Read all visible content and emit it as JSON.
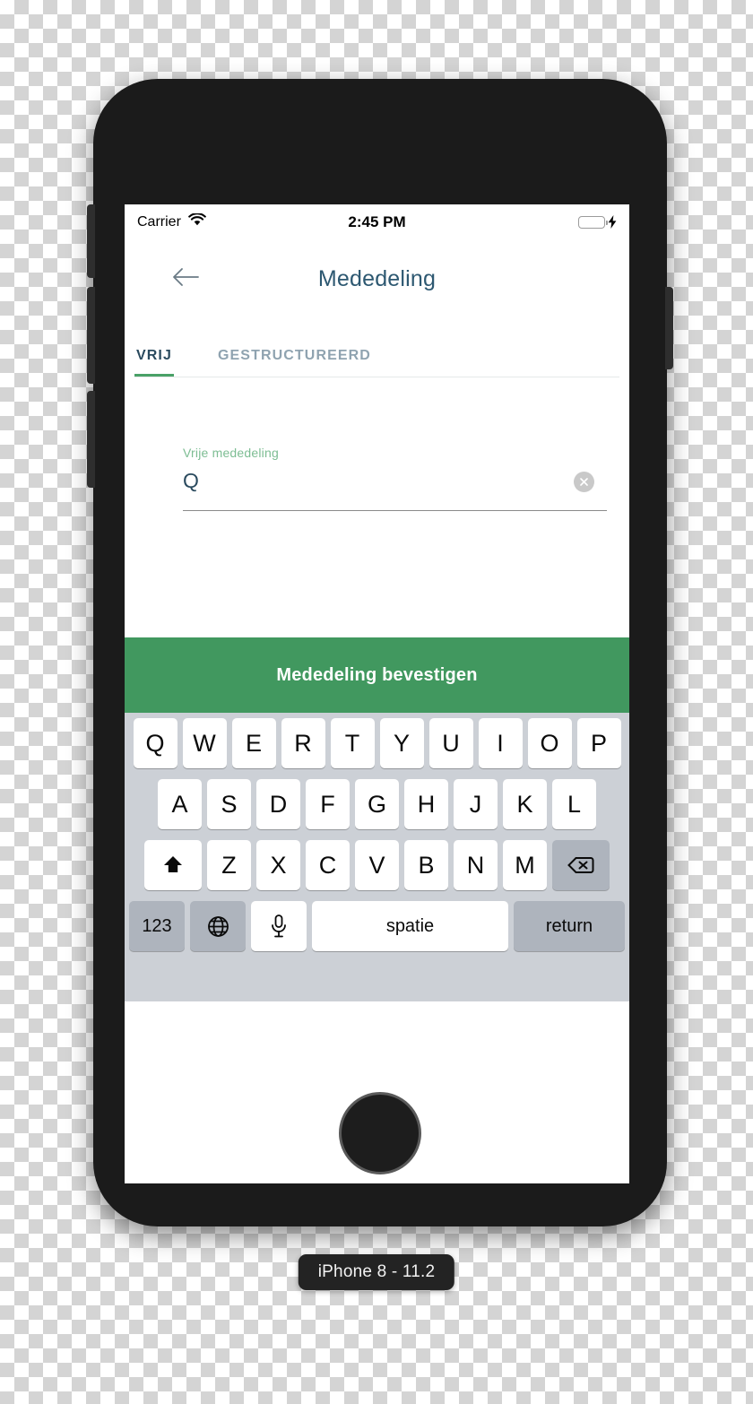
{
  "status_bar": {
    "carrier": "Carrier",
    "wifi_icon": "wifi-icon",
    "time": "2:45 PM",
    "battery_icon": "battery-icon",
    "charging_icon": "⚡",
    "battery_color": "#6fcf74"
  },
  "nav": {
    "back_icon": "arrow-left-icon",
    "title": "Mededeling"
  },
  "tabs": [
    {
      "label": "VRIJ",
      "active": true
    },
    {
      "label": "GESTRUCTUREERD",
      "active": false
    }
  ],
  "form": {
    "field_label": "Vrije mededeling",
    "field_value": "Q",
    "field_placeholder": "Vrije mededeling",
    "clear_icon": "clear-circle-icon"
  },
  "confirm": {
    "label": "Mededeling bevestigen",
    "color": "#41985f"
  },
  "keyboard": {
    "row1": [
      "Q",
      "W",
      "E",
      "R",
      "T",
      "Y",
      "U",
      "I",
      "O",
      "P"
    ],
    "row2": [
      "A",
      "S",
      "D",
      "F",
      "G",
      "H",
      "J",
      "K",
      "L"
    ],
    "row3": [
      "Z",
      "X",
      "C",
      "V",
      "B",
      "N",
      "M"
    ],
    "shift_icon": "shift-icon",
    "backspace_icon": "backspace-icon",
    "numbers_label": "123",
    "globe_icon": "globe-icon",
    "mic_icon": "microphone-icon",
    "space_label": "spatie",
    "return_label": "return"
  },
  "footer": {
    "device_badge": "iPhone 8 - 11.2"
  }
}
